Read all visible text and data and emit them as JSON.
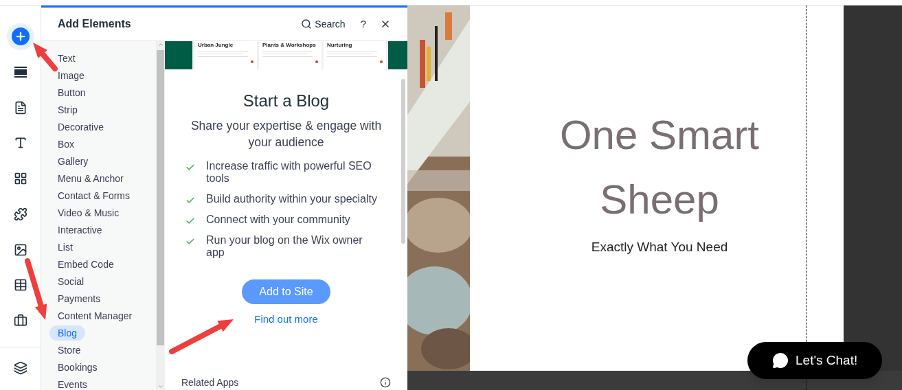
{
  "rail": {
    "items": [
      {
        "selected": true
      },
      {
        "selected": false
      },
      {
        "selected": false
      },
      {
        "selected": false
      },
      {
        "selected": false
      },
      {
        "selected": false
      },
      {
        "selected": false
      },
      {
        "selected": false
      },
      {
        "selected": false
      },
      {
        "selected": false
      }
    ]
  },
  "panel": {
    "title": "Add Elements",
    "search": "Search",
    "help": "?",
    "categories": [
      {
        "label": "Text",
        "selected": false
      },
      {
        "label": "Image",
        "selected": false
      },
      {
        "label": "Button",
        "selected": false
      },
      {
        "label": "Strip",
        "selected": false
      },
      {
        "label": "Decorative",
        "selected": false
      },
      {
        "label": "Box",
        "selected": false
      },
      {
        "label": "Gallery",
        "selected": false
      },
      {
        "label": "Menu & Anchor",
        "selected": false
      },
      {
        "label": "Contact & Forms",
        "selected": false
      },
      {
        "label": "Video & Music",
        "selected": false
      },
      {
        "label": "Interactive",
        "selected": false
      },
      {
        "label": "List",
        "selected": false
      },
      {
        "label": "Embed Code",
        "selected": false
      },
      {
        "label": "Social",
        "selected": false
      },
      {
        "label": "Payments",
        "selected": false
      },
      {
        "label": "Content Manager",
        "selected": false
      },
      {
        "label": "Blog",
        "selected": true
      },
      {
        "label": "Store",
        "selected": false
      },
      {
        "label": "Bookings",
        "selected": false
      },
      {
        "label": "Events",
        "selected": false
      }
    ],
    "preview_cards": [
      "Urban Jungle",
      "Plants & Workshops",
      "Nurturing"
    ],
    "blog": {
      "title": "Start a Blog",
      "subtitle": "Share your expertise & engage with your audience",
      "features": [
        "Increase traffic with powerful SEO tools",
        "Build authority within your specialty",
        "Connect with your community",
        "Run your blog on the Wix owner app"
      ],
      "button": "Add to Site",
      "link": "Find out more",
      "related": "Related Apps"
    }
  },
  "canvas": {
    "heading": "One Smart Sheep",
    "tagline": "Exactly What You Need",
    "chat_button": "Let's Chat!"
  }
}
